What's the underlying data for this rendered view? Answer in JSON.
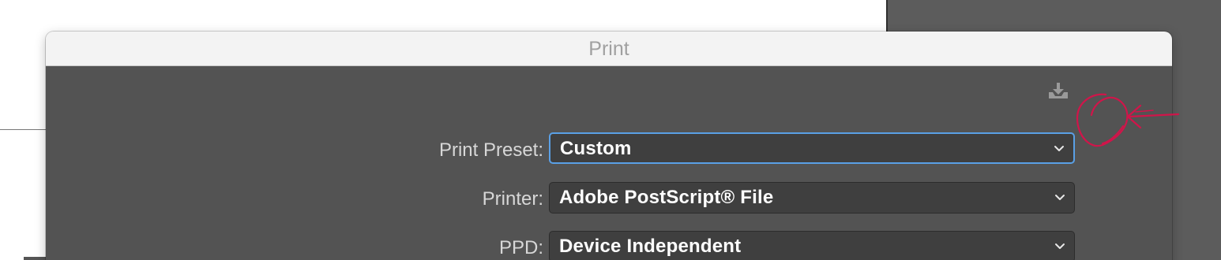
{
  "dialog": {
    "title": "Print"
  },
  "fields": [
    {
      "label": "Print Preset:",
      "value": "Custom"
    },
    {
      "label": "Printer:",
      "value": "Adobe PostScript® File"
    },
    {
      "label": "PPD:",
      "value": "Device Independent"
    }
  ],
  "icons": {
    "save_preset": "download-icon",
    "dropdown": "chevron-down-icon",
    "annotation": "handwritten-circle-arrow"
  },
  "colors": {
    "dialog_body": "#535353",
    "titlebar": "#f3f3f3",
    "focus_ring": "#5aa0e6",
    "annotation": "#d0154a"
  }
}
